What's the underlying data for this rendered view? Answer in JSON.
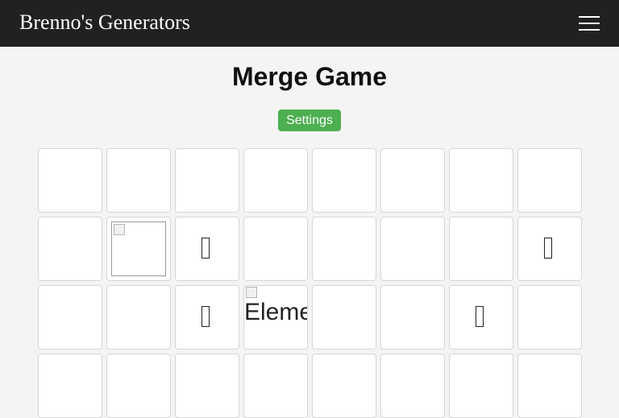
{
  "navbar": {
    "brand": "Brenno's Generators",
    "menu_icon": "hamburger-menu-icon"
  },
  "main": {
    "title": "Merge Game",
    "settings_label": "Settings"
  },
  "grid": {
    "columns": 8,
    "rows": [
      [
        {
          "kind": "empty"
        },
        {
          "kind": "empty"
        },
        {
          "kind": "empty"
        },
        {
          "kind": "empty"
        },
        {
          "kind": "empty"
        },
        {
          "kind": "empty"
        },
        {
          "kind": "empty"
        },
        {
          "kind": "empty"
        }
      ],
      [
        {
          "kind": "empty"
        },
        {
          "kind": "broken-image"
        },
        {
          "kind": "missing-glyph"
        },
        {
          "kind": "empty"
        },
        {
          "kind": "empty"
        },
        {
          "kind": "empty"
        },
        {
          "kind": "empty"
        },
        {
          "kind": "missing-glyph"
        }
      ],
      [
        {
          "kind": "empty"
        },
        {
          "kind": "empty"
        },
        {
          "kind": "missing-glyph"
        },
        {
          "kind": "alt-text",
          "text": "Element"
        },
        {
          "kind": "empty"
        },
        {
          "kind": "empty"
        },
        {
          "kind": "missing-glyph"
        },
        {
          "kind": "empty"
        }
      ],
      [
        {
          "kind": "empty"
        },
        {
          "kind": "empty"
        },
        {
          "kind": "empty"
        },
        {
          "kind": "empty"
        },
        {
          "kind": "empty"
        },
        {
          "kind": "empty"
        },
        {
          "kind": "empty"
        },
        {
          "kind": "empty"
        }
      ]
    ]
  }
}
